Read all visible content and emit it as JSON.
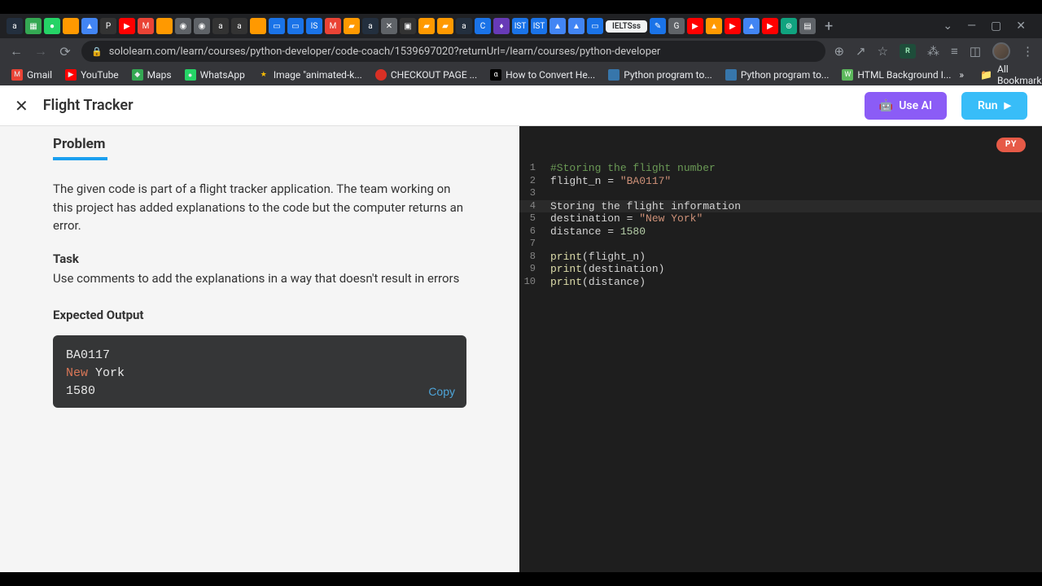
{
  "browser": {
    "url": "sololearn.com/learn/courses/python-developer/code-coach/1539697020?returnUrl=/learn/courses/python-developer",
    "active_tab": "IELTSss",
    "window_controls": {
      "chevron": "⌄",
      "min": "—",
      "max": "▢",
      "close": "✕"
    },
    "new_tab": "+"
  },
  "bookmarks": {
    "items": [
      {
        "label": "Gmail"
      },
      {
        "label": "YouTube"
      },
      {
        "label": "Maps"
      },
      {
        "label": "WhatsApp"
      },
      {
        "label": "Image \"animated-k..."
      },
      {
        "label": "CHECKOUT PAGE ..."
      },
      {
        "label": "How to Convert He..."
      },
      {
        "label": "Python program to..."
      },
      {
        "label": "Python program to..."
      },
      {
        "label": "HTML Background I..."
      }
    ],
    "overflow": "»",
    "all": "All Bookmarks"
  },
  "app": {
    "title": "Flight Tracker",
    "use_ai": "Use AI",
    "run": "Run",
    "tab_label": "Problem"
  },
  "problem": {
    "intro": "The given code is part of a flight tracker application. The team working on this project has added explanations to the code but the computer returns an error.",
    "task_label": "Task",
    "task_text": "Use comments to add the explanations in a way that doesn't result in errors",
    "expected_label": "Expected Output",
    "output_line1": "BA0117",
    "output_new": "New",
    "output_york": " York",
    "output_line3": "1580",
    "copy": "Copy"
  },
  "editor": {
    "lang": "PY",
    "lines": [
      {
        "n": 1,
        "tokens": [
          {
            "t": "#Storing the flight number",
            "c": "tk-comment"
          }
        ]
      },
      {
        "n": 2,
        "tokens": [
          {
            "t": "flight_n ",
            "c": ""
          },
          {
            "t": "= ",
            "c": ""
          },
          {
            "t": "\"BA0117\"",
            "c": "tk-string"
          }
        ]
      },
      {
        "n": 3,
        "tokens": []
      },
      {
        "n": 4,
        "tokens": [
          {
            "t": "Storing the flight information",
            "c": ""
          }
        ],
        "current": true
      },
      {
        "n": 5,
        "tokens": [
          {
            "t": "destination ",
            "c": ""
          },
          {
            "t": "= ",
            "c": ""
          },
          {
            "t": "\"New York\"",
            "c": "tk-string"
          }
        ]
      },
      {
        "n": 6,
        "tokens": [
          {
            "t": "distance ",
            "c": ""
          },
          {
            "t": "= ",
            "c": ""
          },
          {
            "t": "1580",
            "c": "tk-number"
          }
        ]
      },
      {
        "n": 7,
        "tokens": []
      },
      {
        "n": 8,
        "tokens": [
          {
            "t": "print",
            "c": "tk-func"
          },
          {
            "t": "(flight_n)",
            "c": ""
          }
        ]
      },
      {
        "n": 9,
        "tokens": [
          {
            "t": "print",
            "c": "tk-func"
          },
          {
            "t": "(destination)",
            "c": ""
          }
        ]
      },
      {
        "n": 10,
        "tokens": [
          {
            "t": "print",
            "c": "tk-func"
          },
          {
            "t": "(distance)",
            "c": ""
          }
        ]
      }
    ]
  }
}
